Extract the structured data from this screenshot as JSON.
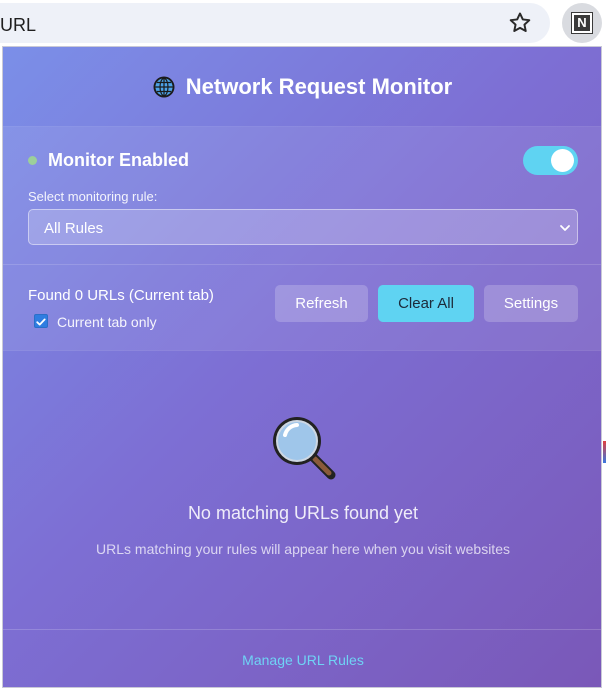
{
  "browser": {
    "address_text": "URL",
    "extension_letter": "N"
  },
  "popup": {
    "title": "Network Request Monitor",
    "monitor_label": "Monitor Enabled",
    "monitor_enabled": true,
    "rule_label": "Select monitoring rule:",
    "rule_selected": "All Rules",
    "found_text": "Found 0 URLs (Current tab)",
    "current_tab_only_label": "Current tab only",
    "current_tab_only_checked": true,
    "buttons": {
      "refresh": "Refresh",
      "clear_all": "Clear All",
      "settings": "Settings"
    },
    "empty": {
      "title": "No matching URLs found yet",
      "subtitle": "URLs matching your rules will appear here when you visit websites"
    },
    "footer_link": "Manage URL Rules"
  },
  "colors": {
    "accent_cyan": "#5fd3f2",
    "link": "#6fd3f5",
    "status_dot": "#9ccf9a",
    "gradient_start": "#7b8fe8",
    "gradient_end": "#7a58b8"
  },
  "icons": {
    "header": "globe-icon",
    "empty_state": "magnifier-icon",
    "bookmark": "star-icon",
    "select": "chevron-down-icon"
  }
}
